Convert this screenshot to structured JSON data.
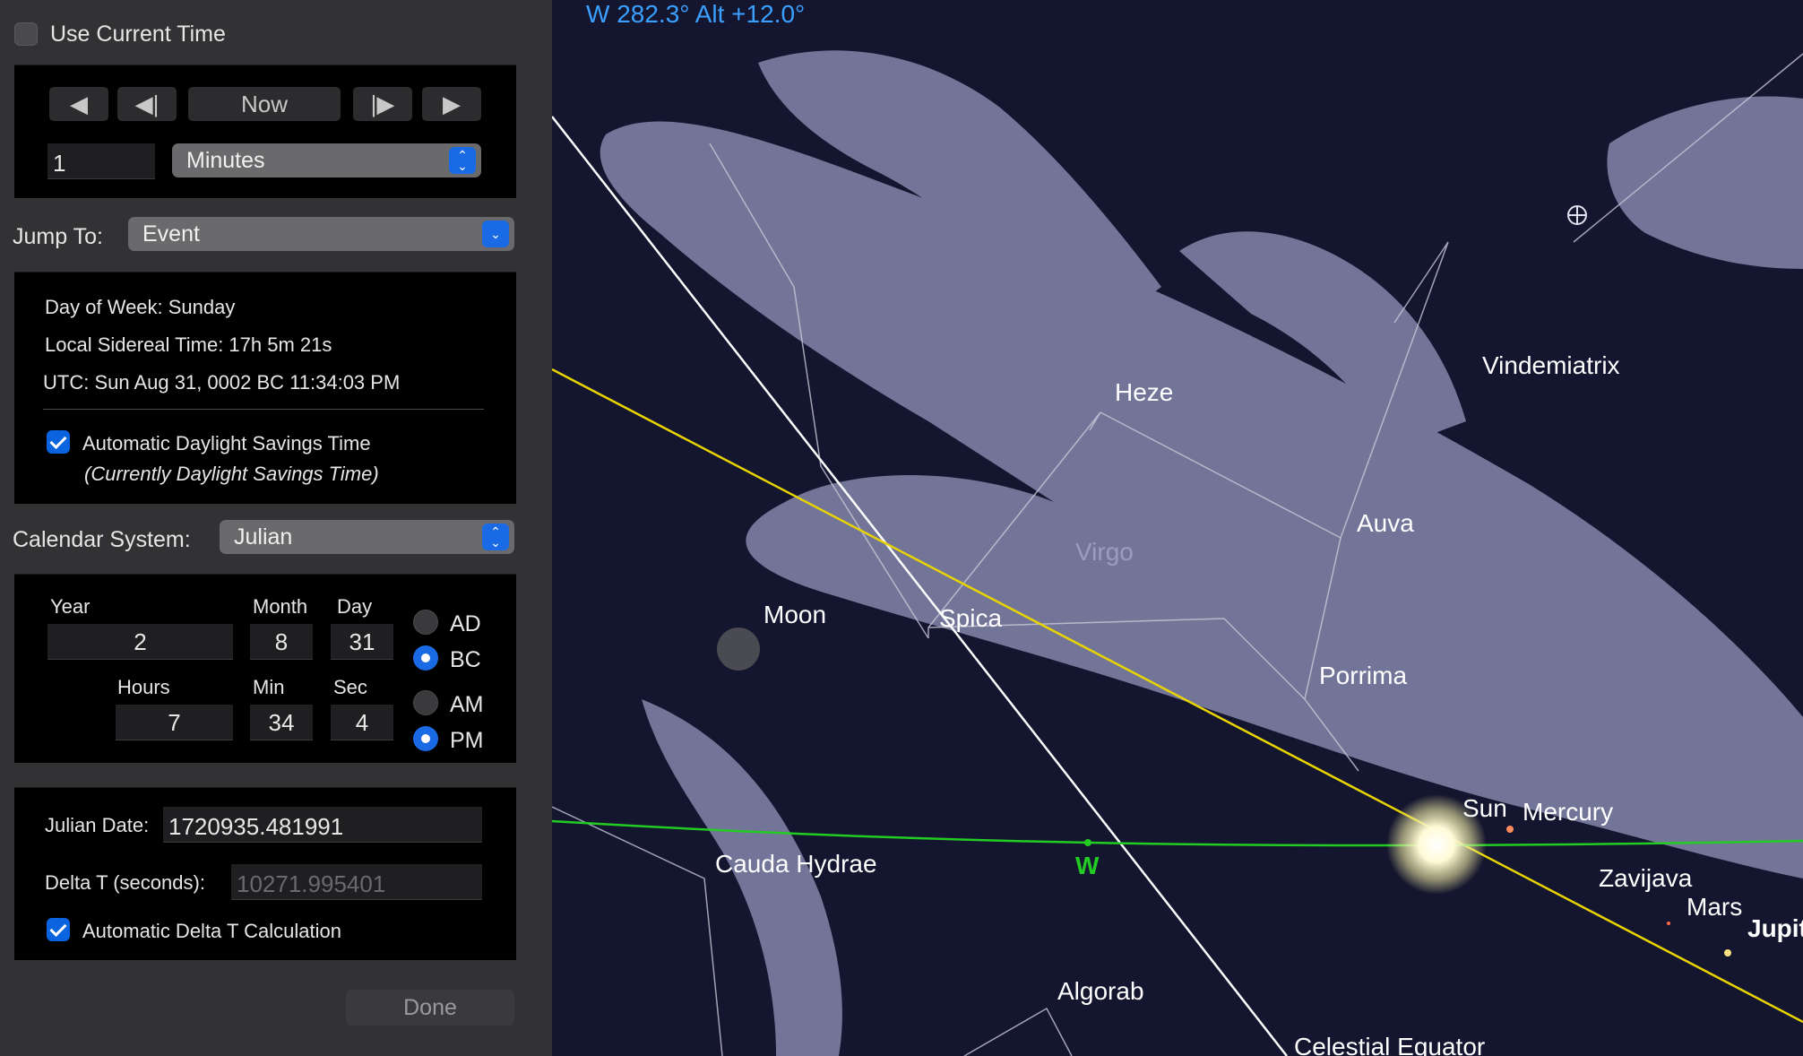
{
  "use_current_time_label": "Use Current Time",
  "nav": {
    "back_fast_label": "◀",
    "back_step_label": "◀|",
    "now_label": "Now",
    "forward_step_label": "|▶",
    "forward_fast_label": "▶"
  },
  "step": {
    "amount": "1",
    "unit": "Minutes"
  },
  "jump_to": {
    "label": "Jump To:",
    "value": "Event"
  },
  "info": {
    "day_of_week": "Day of Week:  Sunday",
    "local_sidereal_time": "Local Sidereal Time:  17h 5m 21s",
    "utc": "UTC:  Sun Aug 31, 0002 BC 11:34:03 PM",
    "auto_dst_label": "Automatic Daylight Savings Time",
    "dst_note": "(Currently Daylight Savings Time)"
  },
  "calendar": {
    "label": "Calendar System:",
    "value": "Julian"
  },
  "date": {
    "year_label": "Year",
    "year": "2",
    "month_label": "Month",
    "month": "8",
    "day_label": "Day",
    "day": "31",
    "hours_label": "Hours",
    "hours": "7",
    "min_label": "Min",
    "min": "34",
    "sec_label": "Sec",
    "sec": "4",
    "ad_label": "AD",
    "bc_label": "BC",
    "am_label": "AM",
    "pm_label": "PM"
  },
  "julian": {
    "jd_label": "Julian Date:",
    "jd_value": "1720935.481991",
    "delta_t_label": "Delta T (seconds):",
    "delta_t_value": "10271.995401",
    "auto_delta_t_label": "Automatic Delta T Calculation"
  },
  "done_label": "Done",
  "sky": {
    "readout": "W 282.3° Alt +12.0°",
    "labels": {
      "heze": "Heze",
      "vindemiatrix": "Vindemiatrix",
      "auva": "Auva",
      "virgo": "Virgo",
      "moon": "Moon",
      "spica": "Spica",
      "porrima": "Porrima",
      "sun": "Sun",
      "mercury": "Mercury",
      "zavijava": "Zavijava",
      "mars": "Mars",
      "jupiter": "Jupit",
      "cauda_hydrae": "Cauda Hydrae",
      "west": "W",
      "algorab": "Algorab",
      "celestial_equator": "Celestial Equator"
    }
  },
  "colors": {
    "accent": "#1a6ae6",
    "readout": "#3aa0ff",
    "ecliptic": "#e8d400",
    "horizon": "#22cc22"
  }
}
